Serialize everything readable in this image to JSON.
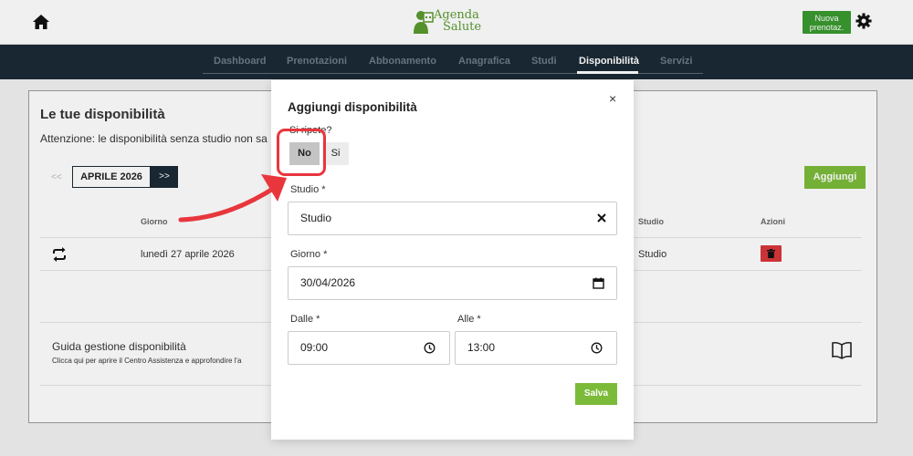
{
  "header": {
    "logo_line1": "Agenda",
    "logo_line2": "Salute",
    "new_booking_line1": "Nuova",
    "new_booking_line2": "prenotaz."
  },
  "nav": {
    "tabs": [
      "Dashboard",
      "Prenotazioni",
      "Abbonamento",
      "Anagrafica",
      "Studi",
      "Disponibilità",
      "Servizi"
    ],
    "active": "Disponibilità"
  },
  "page": {
    "title": "Le tue disponibilità",
    "warning": "Attenzione: le disponibilità senza studio non sa",
    "month_prev": "<<",
    "month": "APRILE 2026",
    "month_next": ">>",
    "add_button": "Aggiungi",
    "columns": {
      "day": "Giorno",
      "studio": "Studio",
      "actions": "Azioni"
    },
    "rows": [
      {
        "day": "lunedì 27 aprile 2026",
        "studio": "Studio"
      }
    ],
    "guide_title": "Guida gestione disponibilità",
    "guide_desc": "Clicca qui per aprire il Centro Assistenza e approfondire l'a"
  },
  "modal": {
    "title": "Aggiungi disponibilità",
    "close": "×",
    "repeat_label": "Si ripete?",
    "repeat_options": [
      "No",
      "Si"
    ],
    "repeat_selected": "No",
    "studio_label": "Studio *",
    "studio_value": "Studio",
    "day_label": "Giorno *",
    "day_value": "30/04/2026",
    "from_label": "Dalle *",
    "from_value": "09:00",
    "to_label": "Alle *",
    "to_value": "13:00",
    "save_button": "Salva"
  },
  "colors": {
    "nav_bg": "#1b2a36",
    "primary_green": "#7cbb3a",
    "delete_red": "#d9373a",
    "annotation_red": "#e8363d"
  }
}
